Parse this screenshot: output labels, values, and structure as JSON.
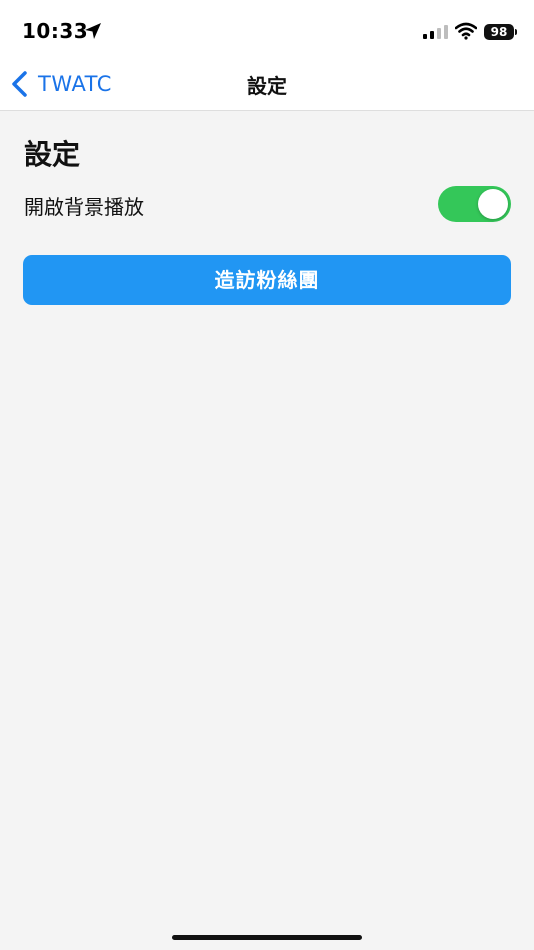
{
  "status_bar": {
    "time": "10:33",
    "battery": "98",
    "icons": [
      "location-arrow-icon",
      "cellular-signal-icon",
      "wifi-icon",
      "battery-icon"
    ]
  },
  "nav": {
    "back_label": "TWATC",
    "title": "設定",
    "accent_color": "#1a73e8"
  },
  "main": {
    "section_title": "設定",
    "background_play": {
      "label": "開啟背景播放",
      "enabled": true,
      "on_color": "#34c759"
    },
    "visit_button": {
      "label": "造訪粉絲團",
      "color": "#2196f3"
    }
  }
}
